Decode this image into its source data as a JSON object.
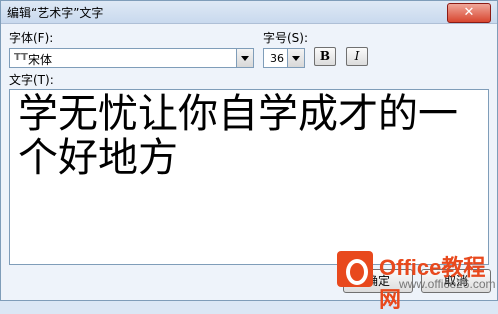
{
  "window": {
    "title": "编辑“艺术字”文字",
    "close_glyph": "✕"
  },
  "font": {
    "label": "字体(F):",
    "value": "宋体",
    "icon": "truetype-icon"
  },
  "size": {
    "label": "字号(S):",
    "value": "36"
  },
  "format": {
    "bold": "B",
    "italic": "I"
  },
  "text": {
    "label": "文字(T):",
    "content": "学无忧让你自学成才的一个好地方"
  },
  "buttons": {
    "ok": "确定",
    "cancel": "取消"
  },
  "watermark": {
    "brand": "Office教程网",
    "url": "www.office26.com"
  }
}
